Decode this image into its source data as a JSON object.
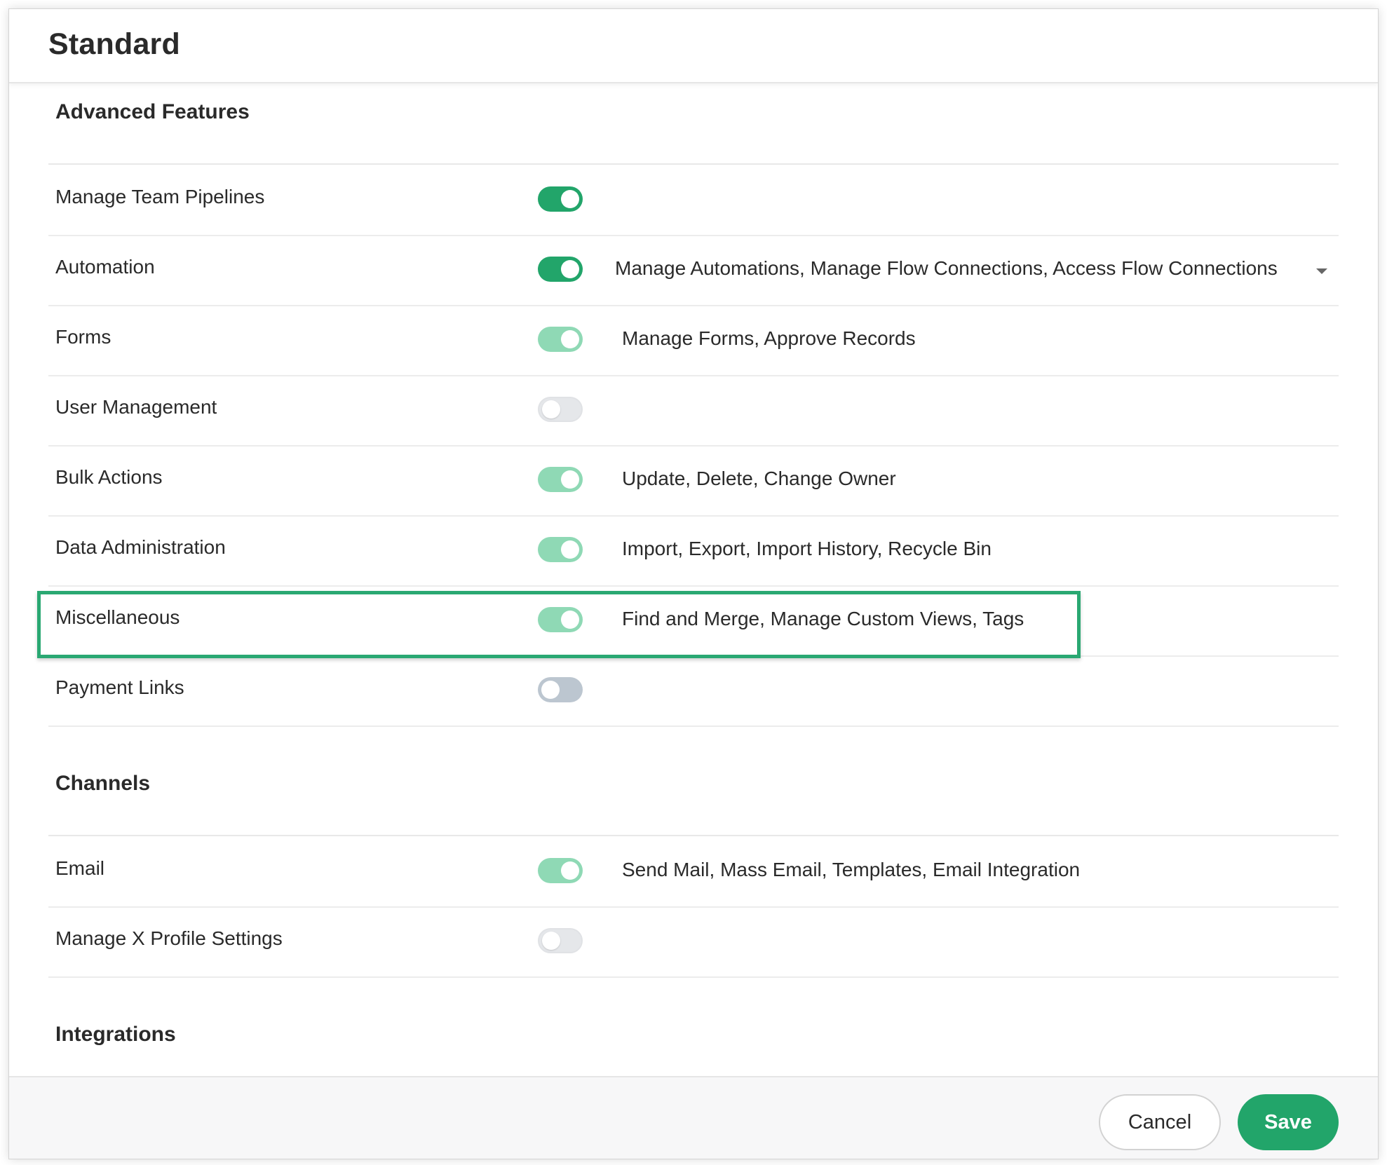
{
  "dialog": {
    "title": "Standard"
  },
  "sections": {
    "advanced": {
      "title": "Advanced Features",
      "rows": [
        {
          "label": "Manage Team Pipelines",
          "toggle_state": "on",
          "detail": ""
        },
        {
          "label": "Automation",
          "toggle_state": "on",
          "detail": "Manage Automations, Manage Flow Connections, Access Flow Connections",
          "has_dropdown": true
        },
        {
          "label": "Forms",
          "toggle_state": "on-disabled",
          "detail": "Manage Forms, Approve Records"
        },
        {
          "label": "User Management",
          "toggle_state": "off-disabled",
          "detail": ""
        },
        {
          "label": "Bulk Actions",
          "toggle_state": "on-disabled",
          "detail": "Update, Delete, Change Owner"
        },
        {
          "label": "Data Administration",
          "toggle_state": "on-disabled",
          "detail": "Import, Export, Import History, Recycle Bin",
          "highlighted": true
        },
        {
          "label": "Miscellaneous",
          "toggle_state": "on-disabled",
          "detail": "Find and Merge, Manage Custom Views, Tags"
        },
        {
          "label": "Payment Links",
          "toggle_state": "off",
          "detail": ""
        }
      ]
    },
    "channels": {
      "title": "Channels",
      "rows": [
        {
          "label": "Email",
          "toggle_state": "on-disabled",
          "detail": "Send Mail, Mass Email, Templates, Email Integration"
        },
        {
          "label": "Manage X Profile Settings",
          "toggle_state": "off-disabled",
          "detail": ""
        }
      ]
    },
    "integrations": {
      "title": "Integrations"
    }
  },
  "footer": {
    "cancel_label": "Cancel",
    "save_label": "Save"
  },
  "colors": {
    "accent_green": "#22a56a",
    "toggle_on_disabled": "#8fd9b5",
    "toggle_off": "#bcc6d0",
    "highlight_border": "#2aa872"
  }
}
